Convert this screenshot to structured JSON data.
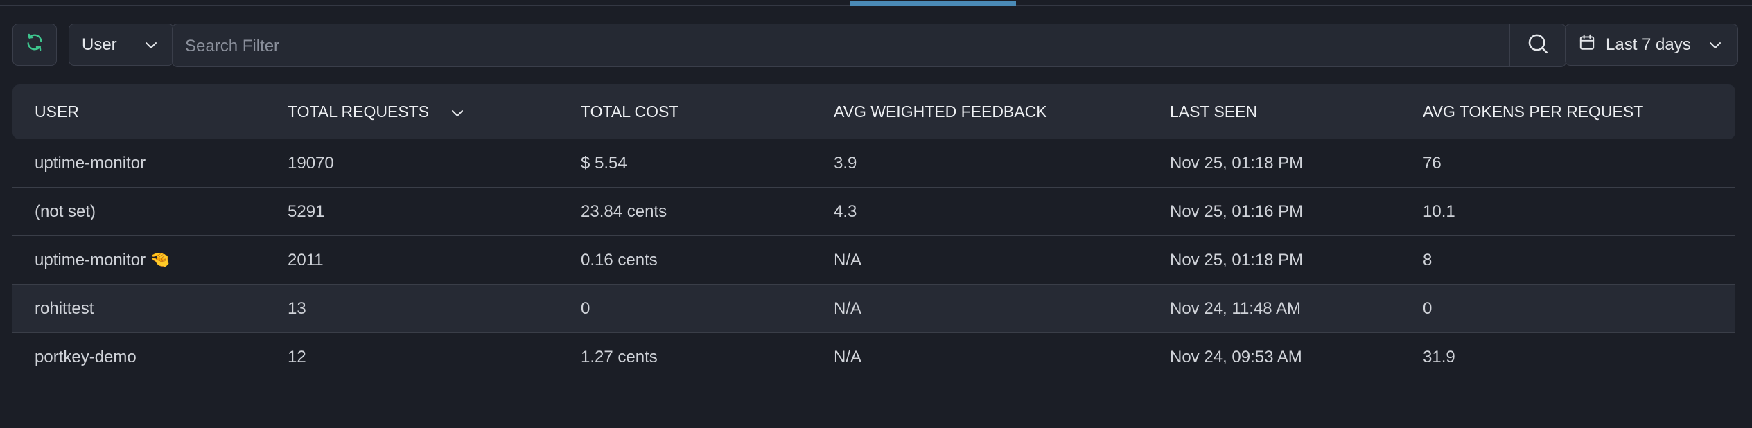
{
  "toolbar": {
    "refresh_icon": "refresh-icon",
    "group_by": "User",
    "search_placeholder": "Search Filter",
    "search_value": "",
    "date_range": "Last 7 days"
  },
  "colors": {
    "background": "#1b1e26",
    "header_bg": "#272b35",
    "accent_refresh": "#3ec58e",
    "tab_indicator": "#4a8ab6"
  },
  "table": {
    "columns": [
      "USER",
      "TOTAL REQUESTS",
      "TOTAL COST",
      "AVG WEIGHTED FEEDBACK",
      "LAST SEEN",
      "AVG TOKENS PER REQUEST"
    ],
    "sorted_column": "TOTAL REQUESTS",
    "rows": [
      {
        "user": "uptime-monitor",
        "emoji": "",
        "requests": "19070",
        "cost": "$ 5.54",
        "feedback": "3.9",
        "last_seen": "Nov 25, 01:18 PM",
        "tokens": "76"
      },
      {
        "user": "(not set)",
        "emoji": "",
        "requests": "5291",
        "cost": "23.84 cents",
        "feedback": "4.3",
        "last_seen": "Nov 25, 01:16 PM",
        "tokens": "10.1"
      },
      {
        "user": "uptime-monitor",
        "emoji": "🤏",
        "requests": "2011",
        "cost": "0.16 cents",
        "feedback": "N/A",
        "last_seen": "Nov 25, 01:18 PM",
        "tokens": "8"
      },
      {
        "user": "rohittest",
        "emoji": "",
        "requests": "13",
        "cost": "0",
        "feedback": "N/A",
        "last_seen": "Nov 24, 11:48 AM",
        "tokens": "0"
      },
      {
        "user": "portkey-demo",
        "emoji": "",
        "requests": "12",
        "cost": "1.27 cents",
        "feedback": "N/A",
        "last_seen": "Nov 24, 09:53 AM",
        "tokens": "31.9"
      }
    ]
  }
}
